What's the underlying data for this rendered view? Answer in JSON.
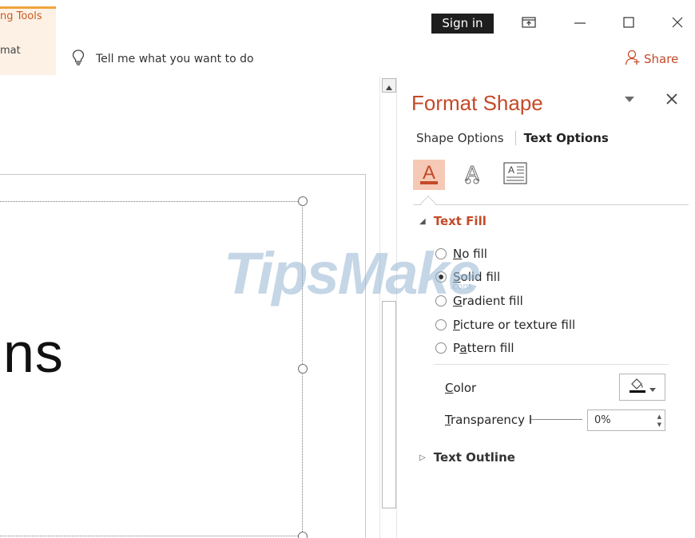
{
  "ribbon": {
    "contextual_tab_label": "ng Tools",
    "format_tab_label": "mat",
    "tell_me_text": "Tell me what you want to do",
    "share_label": "Share",
    "sign_in_label": "Sign in"
  },
  "slide": {
    "visible_text": "ns"
  },
  "pane": {
    "title": "Format Shape",
    "tabs": [
      "Shape Options",
      "Text Options"
    ],
    "active_tab": "Text Options",
    "icon_tabs": [
      "text-fill-outline-icon",
      "text-effects-icon",
      "textbox-icon"
    ],
    "text_fill": {
      "heading": "Text Fill",
      "options": [
        {
          "pre": "",
          "key": "N",
          "post": "o fill",
          "checked": false
        },
        {
          "pre": "",
          "key": "S",
          "post": "olid fill",
          "checked": true
        },
        {
          "pre": "",
          "key": "G",
          "post": "radient fill",
          "checked": false
        },
        {
          "pre": "",
          "key": "P",
          "post": "icture or texture fill",
          "checked": false
        },
        {
          "pre": "P",
          "key": "a",
          "post": "ttern fill",
          "checked": false
        }
      ],
      "color_label_key": "C",
      "color_label_rest": "olor",
      "transparency_label_key": "T",
      "transparency_label_rest": "ransparency",
      "transparency_value": "0%"
    },
    "text_outline_heading": "Text Outline"
  },
  "watermark": {
    "main": "TipsMake",
    "small": ".com"
  },
  "colors": {
    "accent": "#c44a28",
    "tools_tab_bg": "#fdf1e6",
    "sign_in_bg": "#1e1e1e"
  }
}
